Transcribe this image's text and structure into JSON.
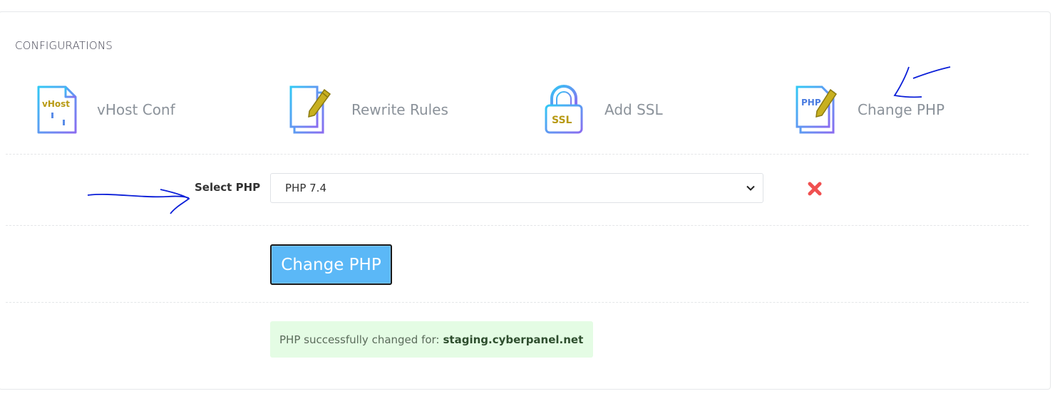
{
  "section": {
    "title": "CONFIGURATIONS"
  },
  "configs": [
    {
      "label": "vHost Conf",
      "icon": "vhost-config-icon",
      "icon_text": "vHost"
    },
    {
      "label": "Rewrite Rules",
      "icon": "rewrite-rules-icon"
    },
    {
      "label": "Add SSL",
      "icon": "ssl-lock-icon",
      "icon_text": "SSL"
    },
    {
      "label": "Change PHP",
      "icon": "php-edit-icon",
      "icon_text": "PHP"
    }
  ],
  "php_form": {
    "label": "Select PHP",
    "selected": "PHP 7.4",
    "button": "Change PHP"
  },
  "alert": {
    "message": "PHP successfully changed for:",
    "domain": "staging.cyberpanel.net"
  },
  "colors": {
    "button": "#5bb8f7",
    "alert_bg": "#e4fce4",
    "remove_icon": "#f05050",
    "annotation": "#0a1ed8"
  }
}
